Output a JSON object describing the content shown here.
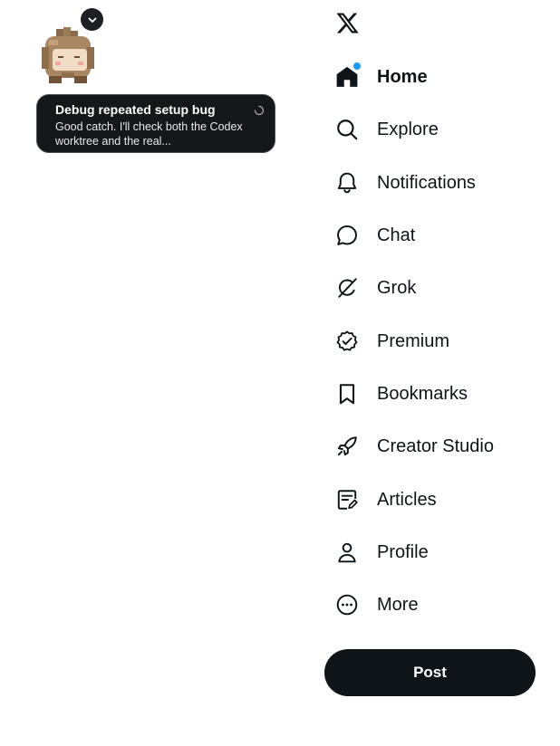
{
  "pet_widget": {
    "collapse_icon": "chevron-down-icon",
    "pet_icon": "pixel-pet-icon",
    "toast": {
      "title": "Debug repeated setup bug",
      "body": "Good catch. I'll check both the Codex worktree and the real...",
      "status_icon": "spinner-icon"
    }
  },
  "nav": {
    "logo_icon": "x-logo-icon",
    "items": [
      {
        "label": "Home",
        "icon": "home-icon",
        "active": true,
        "has_notification_dot": true
      },
      {
        "label": "Explore",
        "icon": "search-icon",
        "active": false
      },
      {
        "label": "Notifications",
        "icon": "bell-icon",
        "active": false
      },
      {
        "label": "Chat",
        "icon": "chat-bubble-icon",
        "active": false
      },
      {
        "label": "Grok",
        "icon": "grok-icon",
        "active": false
      },
      {
        "label": "Premium",
        "icon": "verified-badge-icon",
        "active": false
      },
      {
        "label": "Bookmarks",
        "icon": "bookmark-icon",
        "active": false
      },
      {
        "label": "Creator Studio",
        "icon": "rocket-icon",
        "active": false
      },
      {
        "label": "Articles",
        "icon": "article-icon",
        "active": false
      },
      {
        "label": "Profile",
        "icon": "person-icon",
        "active": false
      },
      {
        "label": "More",
        "icon": "more-circle-icon",
        "active": false
      }
    ],
    "post_label": "Post"
  },
  "colors": {
    "text": "#0f1419",
    "accent_dot": "#1d9bf0",
    "toast_bg": "#15171a",
    "post_bg": "#0f1419"
  }
}
